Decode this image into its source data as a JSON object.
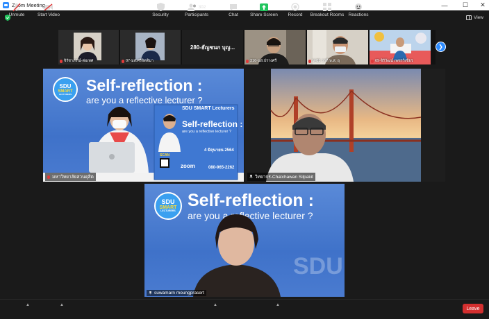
{
  "window": {
    "title": "Zoom Meeting",
    "minimize": "—",
    "maximize": "☐",
    "close": "✕"
  },
  "view_label": "View",
  "gallery": [
    {
      "name": "จิรัชาภรณ์-ต่อเทศ"
    },
    {
      "name": "07-มส.ศรีจิตติมา"
    },
    {
      "name": "280-ธัญชนก บุญ..."
    },
    {
      "name": "316-นส.ปรางศรี"
    },
    {
      "name": "V-01 วาที ษ.ส. อุ"
    },
    {
      "name": "69-จิรัวัฒน์ เพชรวิเชียร"
    }
  ],
  "main_videos": [
    {
      "name": "มหาวิทยาลัยสวนดุสิต"
    },
    {
      "name": "วิทยากร-Chatchawan Silpakit"
    },
    {
      "name": "suwamarn moungprasert"
    }
  ],
  "slide": {
    "logo_top": "SDU",
    "logo_mid": "SMART",
    "logo_bottom": "LECTURERS",
    "headline": "Self-reflection :",
    "subline": "are you a reflective lecturer ?",
    "poster_heading": "SDU SMART Lecturers",
    "poster_title": "Self-reflection :",
    "poster_sub": "are you a reflective lecturer ?",
    "poster_date": "4 มิถุนายน 2564",
    "poster_scan": "SCAN",
    "poster_zoom": "zoom",
    "poster_phone": "080-965-2262",
    "watermark": "SDU"
  },
  "toolbar": {
    "unmute": "Unmute",
    "start_video": "Start Video",
    "security": "Security",
    "participants": "Participants",
    "participants_count": "302",
    "chat": "Chat",
    "share_screen": "Share Screen",
    "record": "Record",
    "breakout": "Breakout Rooms",
    "reactions": "Reactions",
    "leave": "Leave"
  },
  "colors": {
    "accent": "#2d8cff",
    "share": "#22c55e",
    "leave": "#d32f2f",
    "banner": "#4a7bd0"
  }
}
